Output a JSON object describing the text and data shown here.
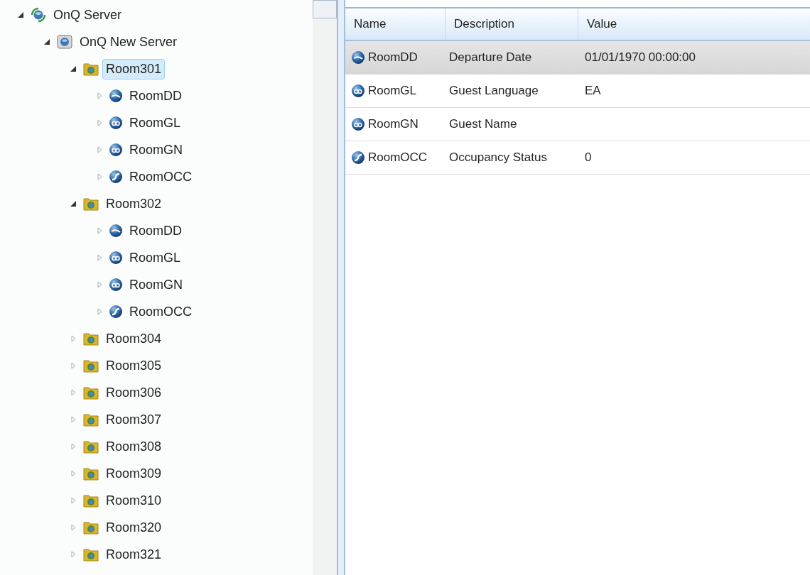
{
  "tree": [
    {
      "label": "OnQ Server",
      "kind": "server",
      "expanded": true,
      "selected": false,
      "children": [
        {
          "label": "OnQ New Server",
          "kind": "device",
          "expanded": true,
          "selected": false,
          "children": [
            {
              "label": "Room301",
              "kind": "room",
              "expanded": true,
              "selected": true,
              "children": [
                {
                  "label": "RoomDD",
                  "kind": "date",
                  "expanded": false,
                  "selected": false
                },
                {
                  "label": "RoomGL",
                  "kind": "text",
                  "expanded": false,
                  "selected": false
                },
                {
                  "label": "RoomGN",
                  "kind": "text",
                  "expanded": false,
                  "selected": false
                },
                {
                  "label": "RoomOCC",
                  "kind": "status",
                  "expanded": false,
                  "selected": false
                }
              ]
            },
            {
              "label": "Room302",
              "kind": "room",
              "expanded": true,
              "selected": false,
              "children": [
                {
                  "label": "RoomDD",
                  "kind": "date",
                  "expanded": false,
                  "selected": false
                },
                {
                  "label": "RoomGL",
                  "kind": "text",
                  "expanded": false,
                  "selected": false
                },
                {
                  "label": "RoomGN",
                  "kind": "text",
                  "expanded": false,
                  "selected": false
                },
                {
                  "label": "RoomOCC",
                  "kind": "status",
                  "expanded": false,
                  "selected": false
                }
              ]
            },
            {
              "label": "Room304",
              "kind": "room",
              "expanded": false,
              "selected": false
            },
            {
              "label": "Room305",
              "kind": "room",
              "expanded": false,
              "selected": false
            },
            {
              "label": "Room306",
              "kind": "room",
              "expanded": false,
              "selected": false
            },
            {
              "label": "Room307",
              "kind": "room",
              "expanded": false,
              "selected": false
            },
            {
              "label": "Room308",
              "kind": "room",
              "expanded": false,
              "selected": false
            },
            {
              "label": "Room309",
              "kind": "room",
              "expanded": false,
              "selected": false
            },
            {
              "label": "Room310",
              "kind": "room",
              "expanded": false,
              "selected": false
            },
            {
              "label": "Room320",
              "kind": "room",
              "expanded": false,
              "selected": false
            },
            {
              "label": "Room321",
              "kind": "room",
              "expanded": false,
              "selected": false
            }
          ]
        }
      ]
    }
  ],
  "table": {
    "columns": [
      "Name",
      "Description",
      "Value"
    ],
    "rows": [
      {
        "kind": "date",
        "name": "RoomDD",
        "description": "Departure Date",
        "value": "01/01/1970 00:00:00",
        "selected": true
      },
      {
        "kind": "text",
        "name": "RoomGL",
        "description": "Guest Language",
        "value": "EA",
        "selected": false
      },
      {
        "kind": "text",
        "name": "RoomGN",
        "description": "Guest Name",
        "selected": false
      },
      {
        "kind": "status",
        "name": "RoomOCC",
        "description": "Occupancy Status",
        "value": "0",
        "selected": false
      }
    ]
  }
}
